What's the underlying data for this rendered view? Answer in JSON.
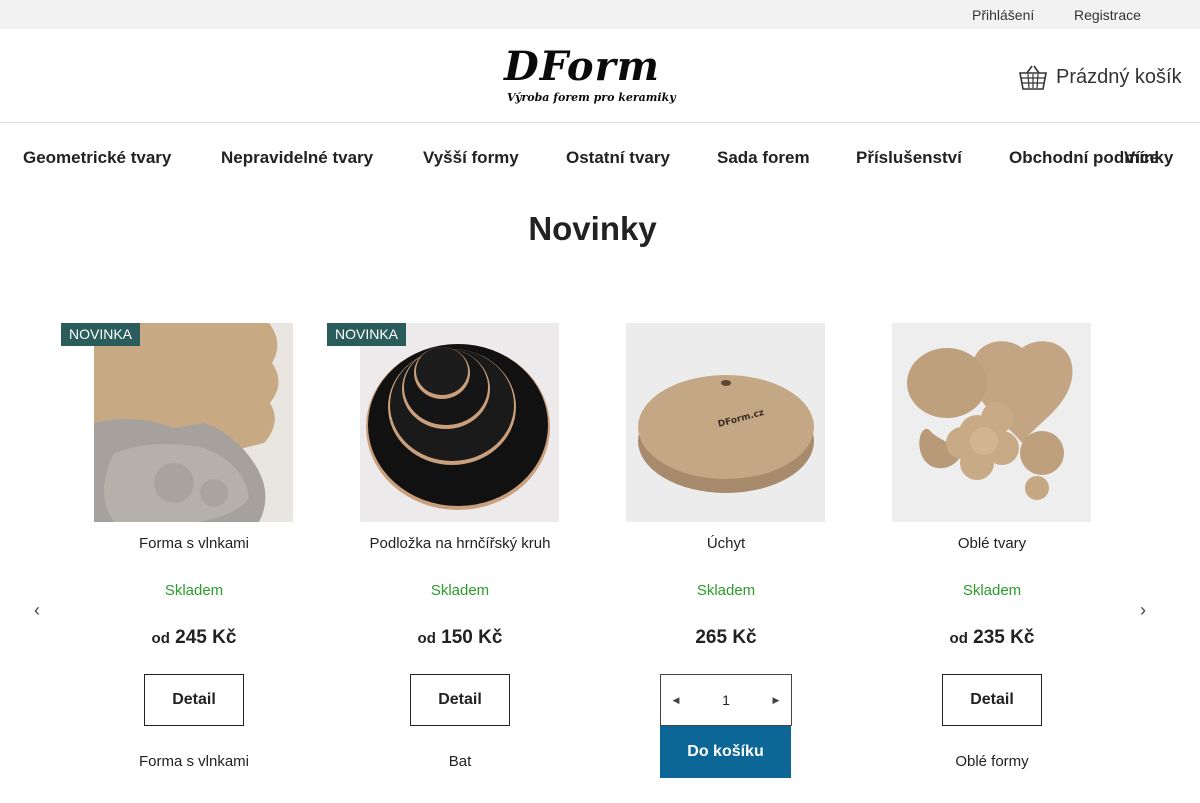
{
  "topbar": {
    "login": "Přihlášení",
    "register": "Registrace"
  },
  "header": {
    "logo_main": "DForm",
    "logo_sub": "Výroba forem pro keramiky",
    "cart_label": "Prázdný košík",
    "cart_icon": "basket-icon"
  },
  "nav": {
    "items": [
      "Geometrické tvary",
      "Nepravidelné tvary",
      "Vyšší formy",
      "Ostatní tvary",
      "Sada forem",
      "Příslušenství",
      "Obchodní podmínky"
    ],
    "more": "Více"
  },
  "section": {
    "title": "Novinky"
  },
  "carousel": {
    "prev_icon": "chevron-left-icon",
    "next_icon": "chevron-right-icon"
  },
  "products": [
    {
      "badge": "NOVINKA",
      "name": "Forma s vlnkami",
      "stock": "Skladem",
      "price_prefix": "od",
      "price": "245 Kč",
      "button": "Detail",
      "next_name": "Forma s vlnkami"
    },
    {
      "badge": "NOVINKA",
      "name": "Podložka na hrnčířský kruh",
      "stock": "Skladem",
      "price_prefix": "od",
      "price": "150 Kč",
      "button": "Detail",
      "next_name": "Bat"
    },
    {
      "name": "Úchyt",
      "stock": "Skladem",
      "price": "265 Kč",
      "qty": "1",
      "button": "Do košíku"
    },
    {
      "name": "Oblé tvary",
      "stock": "Skladem",
      "price_prefix": "od",
      "price": "235 Kč",
      "button": "Detail",
      "next_name": "Oblé formy"
    }
  ],
  "colors": {
    "badge": "#2b5c5c",
    "stock": "#2a9d2a",
    "cart_button": "#0d6796",
    "topbar": "#f2f2f2"
  }
}
